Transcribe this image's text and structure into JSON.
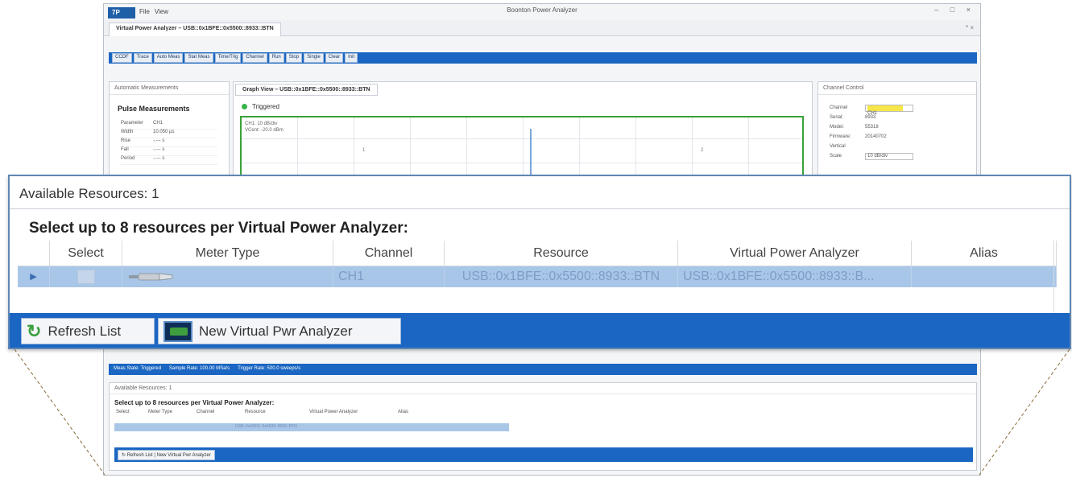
{
  "app": {
    "title": "Boonton Power Analyzer",
    "logo": "7P",
    "menu": [
      "File",
      "View"
    ],
    "window_controls": "– □ ×",
    "doc_tab": "Virtual Power Analyzer – USB::0x1BFE::0x5500::8933::BTN",
    "doc_close": "* ×"
  },
  "toolbar": [
    "CCDF",
    "Trace",
    "Auto Meas",
    "Stat Meas",
    "Time/Trig",
    "Channel",
    "Run",
    "Stop",
    "Single",
    "Clear",
    "Init"
  ],
  "auto_meas": {
    "header": "Automatic Measurements",
    "title": "Pulse Measurements",
    "rows": [
      [
        "Parameter",
        "CH1"
      ],
      [
        "Width",
        "10.050 µs"
      ],
      [
        "Rise",
        "-.--- s"
      ],
      [
        "Fall",
        "-.--- s"
      ],
      [
        "Period",
        "-.--- s"
      ]
    ]
  },
  "graph": {
    "tab": "Graph View – USB::0x1BFE::0x5500::8933::BTN",
    "state": "Triggered",
    "info_line1": "CH1: 10 dB/div",
    "info_line2": "VCent: -20.0 dBm",
    "marker1": "1",
    "marker2": "2"
  },
  "channel_control": {
    "header": "Channel Control",
    "channel_label": "Channel",
    "channel_value": "CH1",
    "serial_label": "Serial:",
    "serial_value": "8933",
    "model_label": "Model:",
    "model_value": "55318",
    "firmware_label": "Firmware:",
    "firmware_value": "20140702",
    "vertical_label": "Vertical",
    "scale_label": "Scale",
    "scale_value": "10 dB/div"
  },
  "status_bar": {
    "meas_state": "Meas State: Triggered",
    "sample_rate": "Sample Rate: 100.00 MSa/s",
    "trigger_rate": "Trigger Rate: 500.0 sweeps/s"
  },
  "resources": {
    "available": "Available Resources: 1",
    "title": "Select up to 8 resources per Virtual Power Analyzer:",
    "columns": {
      "select": "Select",
      "meter_type": "Meter Type",
      "channel": "Channel",
      "resource": "Resource",
      "vpa": "Virtual Power Analyzer",
      "alias": "Alias"
    },
    "row": {
      "channel": "CH1",
      "resource": "USB::0x1BFE::0x5500::8933::BTN",
      "vpa": "USB::0x1BFE::0x5500::8933::B..."
    },
    "refresh_label": "Refresh List",
    "new_vpa_label": "New Virtual Pwr Analyzer",
    "mini_new_vpa_label": "New Virtual Pwr Analyzer"
  },
  "colors": {
    "accent_blue": "#1a66c2",
    "selected_row": "#a8c6e8",
    "trace_green": "#3aa13a"
  }
}
